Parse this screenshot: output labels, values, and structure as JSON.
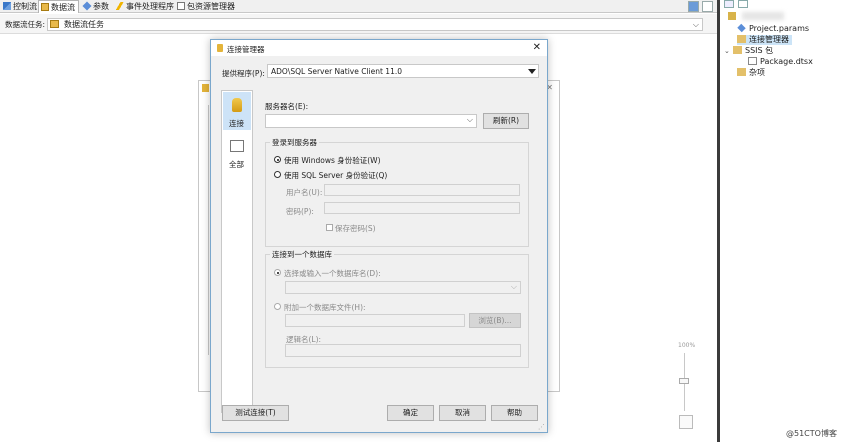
{
  "tabs": [
    {
      "label": "控制流",
      "icon": "control-flow-icon"
    },
    {
      "label": "数据流",
      "icon": "data-flow-icon",
      "active": true
    },
    {
      "label": "参数",
      "icon": "parameters-icon"
    },
    {
      "label": "事件处理程序",
      "icon": "event-handler-icon"
    },
    {
      "label": "包资源管理器",
      "icon": "package-explorer-icon"
    }
  ],
  "dataflow": {
    "label": "数据流任务:",
    "combo_value": "数据流任务"
  },
  "explorer": {
    "items": [
      "Project.params",
      "连接管理器",
      "SSIS 包",
      "Package.dtsx",
      "杂项"
    ],
    "selected": "连接管理器"
  },
  "dialog": {
    "title": "连接管理器",
    "provider_label": "提供程序(P):",
    "provider_value": "ADO\\SQL Server Native Client 11.0",
    "nav": [
      {
        "label": "连接",
        "icon": "connection-icon"
      },
      {
        "label": "全部",
        "icon": "all-properties-icon"
      }
    ],
    "server_label": "服务器名(E):",
    "server_value": "",
    "refresh": "刷新(R)",
    "login_group": "登录到服务器",
    "win_auth": "使用 Windows 身份验证(W)",
    "sql_auth": "使用 SQL Server 身份验证(Q)",
    "user_label": "用户名(U):",
    "pwd_label": "密码(P):",
    "save_pwd": "保存密码(S)",
    "db_group": "连接到一个数据库",
    "select_db": "选择或输入一个数据库名(D):",
    "attach_db": "附加一个数据库文件(H):",
    "browse": "浏览(B)...",
    "logical_name": "逻辑名(L):",
    "test": "测试连接(T)",
    "ok": "确定",
    "cancel": "取消",
    "help": "帮助"
  },
  "zoom": {
    "label": "100%"
  },
  "watermark": "@51CTO博客"
}
